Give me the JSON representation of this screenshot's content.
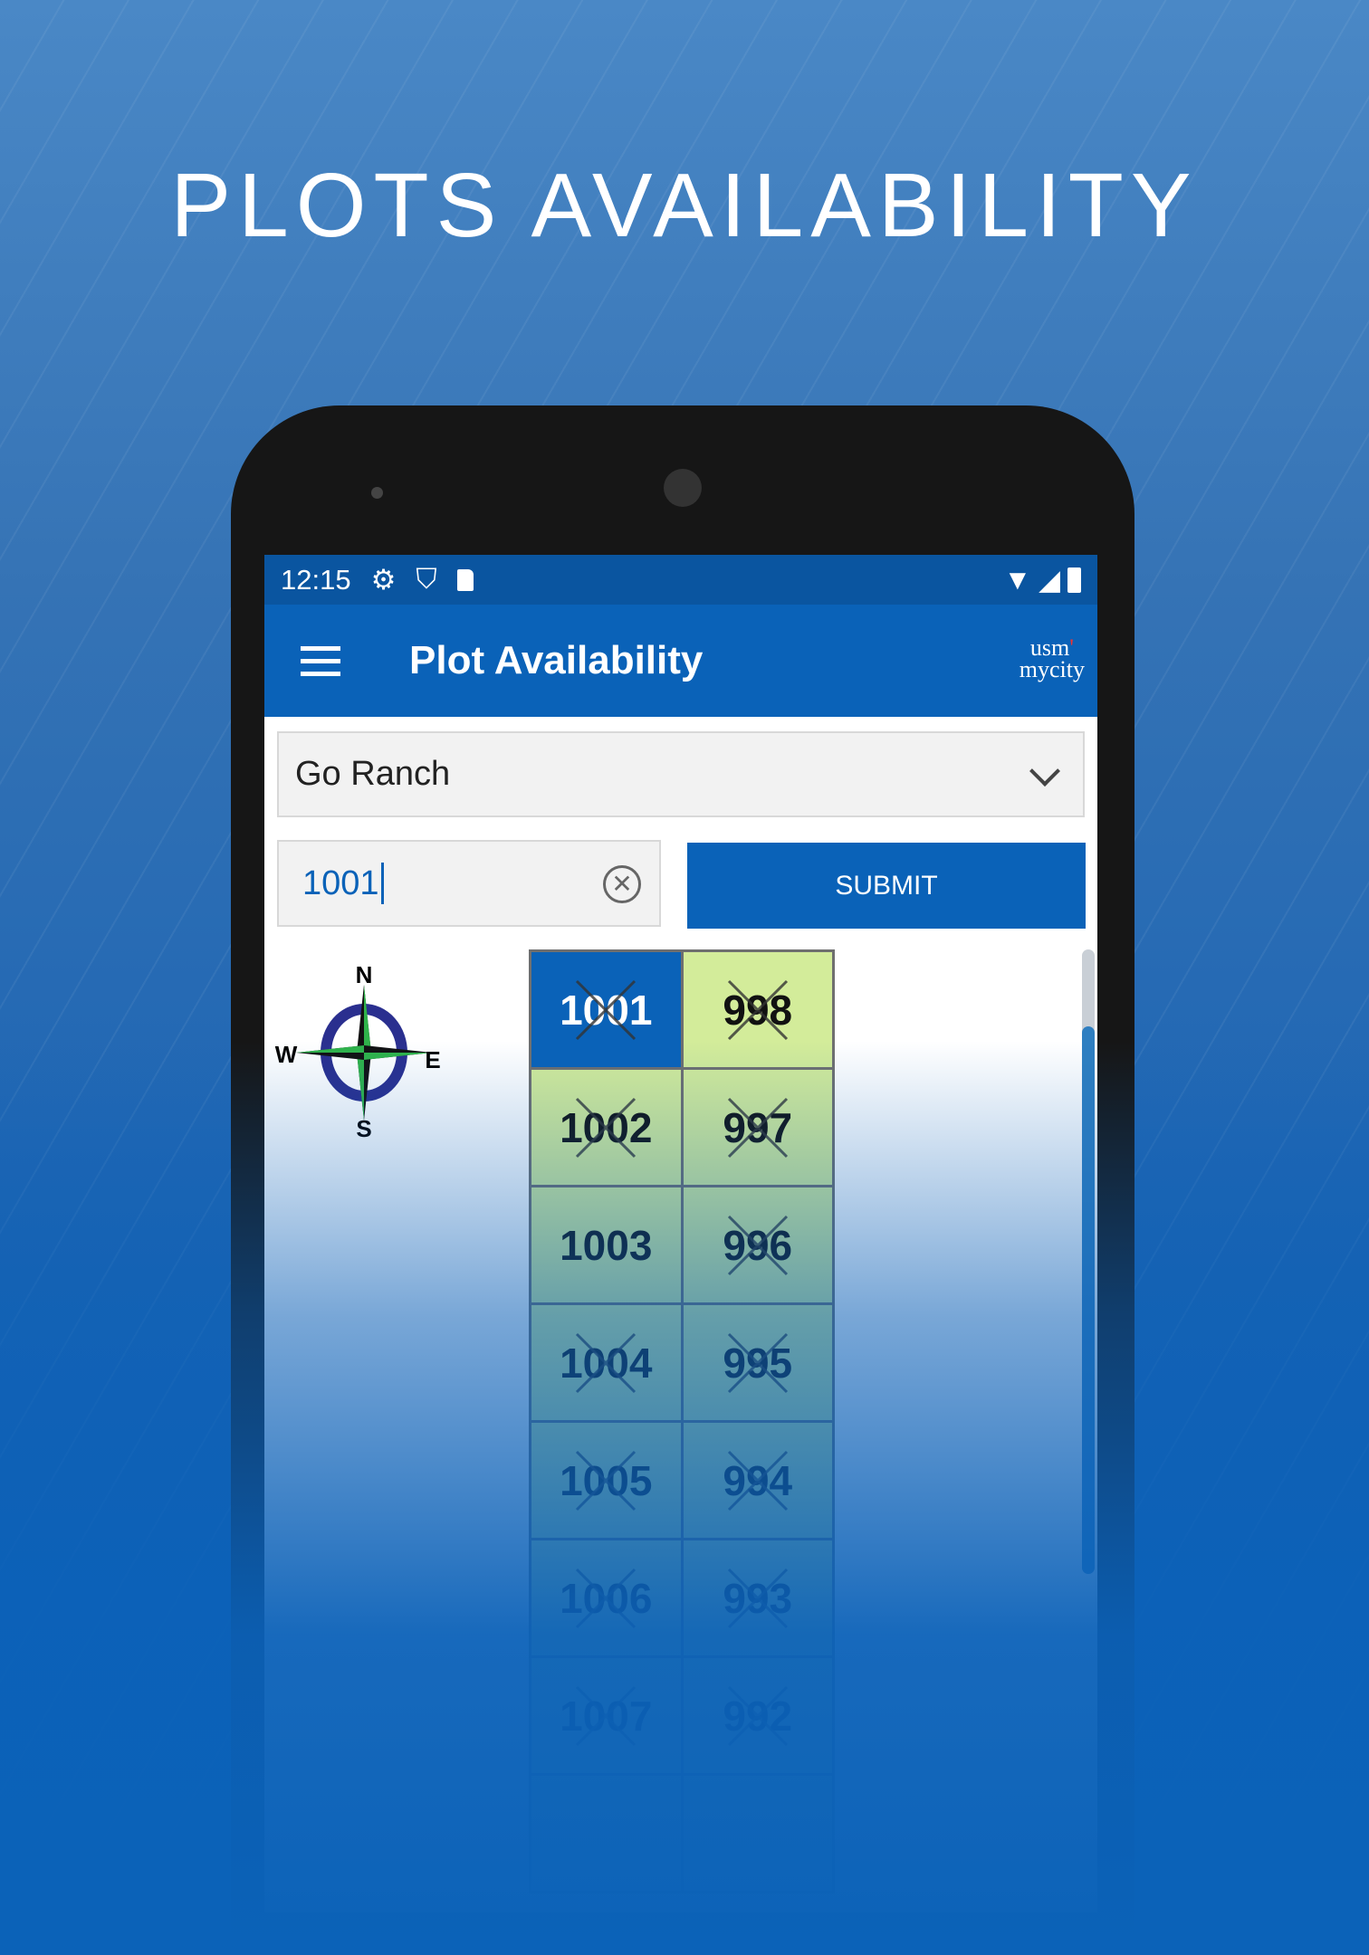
{
  "headline": "PLOTS AVAILABILITY",
  "status_bar": {
    "time": "12:15",
    "icons": [
      "gear-icon",
      "shield-play-icon",
      "sd-card-icon",
      "wifi-icon",
      "signal-icon",
      "battery-icon"
    ]
  },
  "app_bar": {
    "title": "Plot Availability",
    "logo_top": "usm",
    "logo_bottom": "mycity",
    "menu_icon": "hamburger-icon"
  },
  "project_select": {
    "value": "Go Ranch"
  },
  "plot_input": {
    "value": "1001"
  },
  "submit_label": "SUBMIT",
  "compass": {
    "n": "N",
    "e": "E",
    "s": "S",
    "w": "W"
  },
  "colors": {
    "primary": "#0a62b8",
    "available": "#d3ec9a",
    "selected": "#0a62b8"
  },
  "plots": [
    {
      "left": {
        "no": "1001",
        "sold": true,
        "selected": true
      },
      "right": {
        "no": "998",
        "sold": true
      }
    },
    {
      "left": {
        "no": "1002",
        "sold": true
      },
      "right": {
        "no": "997",
        "sold": true
      }
    },
    {
      "left": {
        "no": "1003",
        "sold": false
      },
      "right": {
        "no": "996",
        "sold": true
      }
    },
    {
      "left": {
        "no": "1004",
        "sold": true
      },
      "right": {
        "no": "995",
        "sold": true
      }
    },
    {
      "left": {
        "no": "1005",
        "sold": true
      },
      "right": {
        "no": "994",
        "sold": true
      }
    },
    {
      "left": {
        "no": "1006",
        "sold": true
      },
      "right": {
        "no": "993",
        "sold": true
      }
    },
    {
      "left": {
        "no": "1007",
        "sold": true
      },
      "right": {
        "no": "992",
        "sold": true
      }
    },
    {
      "left": {
        "no": "",
        "sold": false
      },
      "right": {
        "no": "",
        "sold": false
      }
    }
  ]
}
